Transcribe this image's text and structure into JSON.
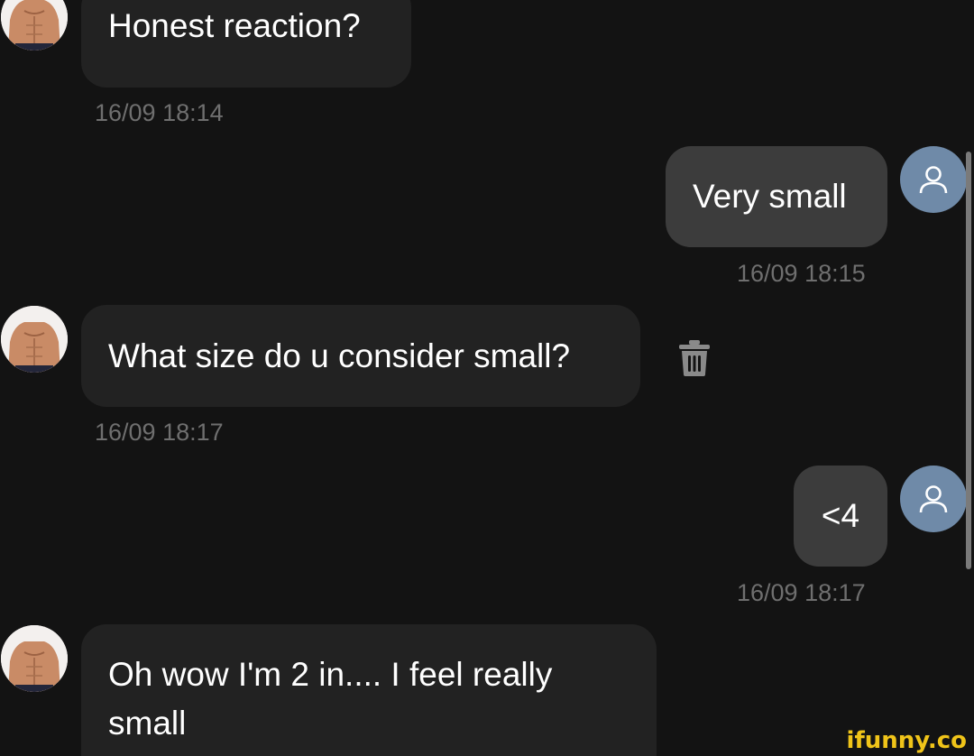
{
  "messages": [
    {
      "direction": "incoming",
      "text": "Honest reaction?",
      "time": "16/09 18:14"
    },
    {
      "direction": "outgoing",
      "text": "Very small",
      "time": "16/09 18:15"
    },
    {
      "direction": "incoming",
      "text": "What size do u consider small?",
      "time": "16/09 18:17"
    },
    {
      "direction": "outgoing",
      "text": "<4",
      "time": "16/09 18:17"
    },
    {
      "direction": "incoming",
      "text": "Oh wow I'm 2 in.... I feel really small",
      "time": ""
    }
  ],
  "icons": {
    "contact_avatar": "contact-photo-avatar",
    "user_avatar": "user-silhouette-icon",
    "delete": "trash-icon"
  },
  "colors": {
    "background": "#131313",
    "incoming_bubble": "#222222",
    "outgoing_bubble": "#3c3c3c",
    "user_avatar": "#6f8aa8",
    "timestamp": "#6f6f6f",
    "watermark": "#f0c419"
  },
  "watermark": "ifunny.co"
}
